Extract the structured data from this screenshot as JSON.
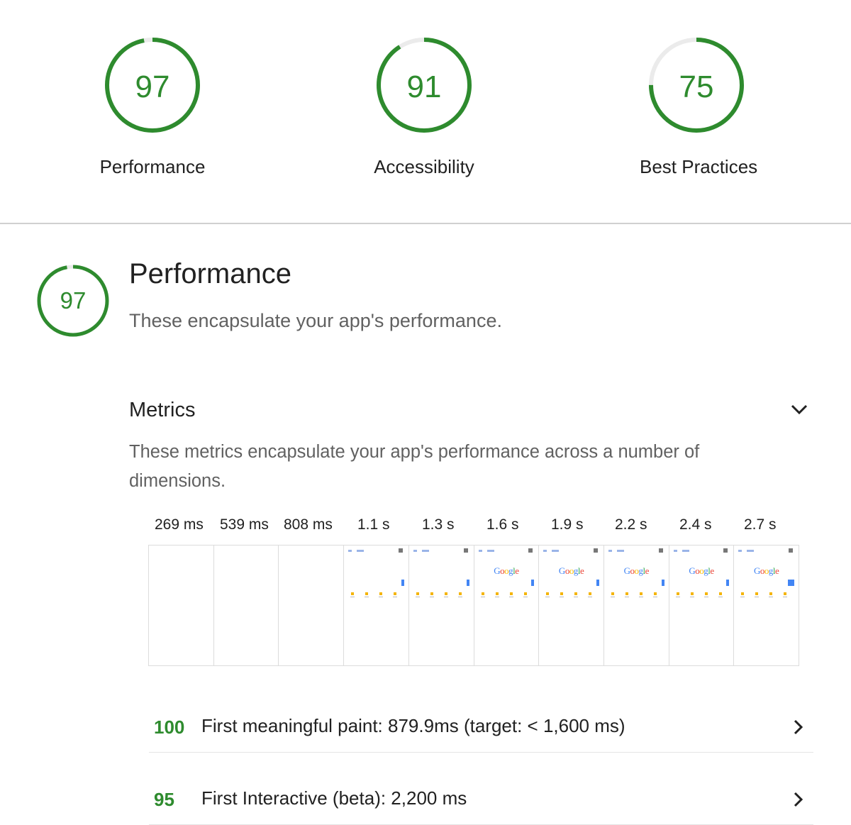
{
  "summary": {
    "gauges": [
      {
        "score": "97",
        "label": "Performance",
        "fraction": 0.97
      },
      {
        "score": "91",
        "label": "Accessibility",
        "fraction": 0.91
      },
      {
        "score": "75",
        "label": "Best Practices",
        "fraction": 0.75
      }
    ]
  },
  "category": {
    "score": "97",
    "fraction": 0.97,
    "title": "Performance",
    "description": "These encapsulate your app's performance."
  },
  "metrics": {
    "title": "Metrics",
    "description": "These metrics encapsulate your app's performance across a number of dimensions.",
    "timeline": [
      "269 ms",
      "539 ms",
      "808 ms",
      "1.1 s",
      "1.3 s",
      "1.6 s",
      "1.9 s",
      "2.2 s",
      "2.4 s",
      "2.7 s"
    ],
    "frame_logo_text": "Google",
    "audits": [
      {
        "score": "100",
        "text": "First meaningful paint: 879.9ms (target: < 1,600 ms)"
      },
      {
        "score": "95",
        "text": "First Interactive (beta): 2,200 ms"
      }
    ]
  },
  "colors": {
    "pass": "#2e8b2e",
    "track": "#ebebeb",
    "accent": "#4285f4"
  },
  "icons": [
    "chevron-down-icon",
    "chevron-right-icon"
  ]
}
